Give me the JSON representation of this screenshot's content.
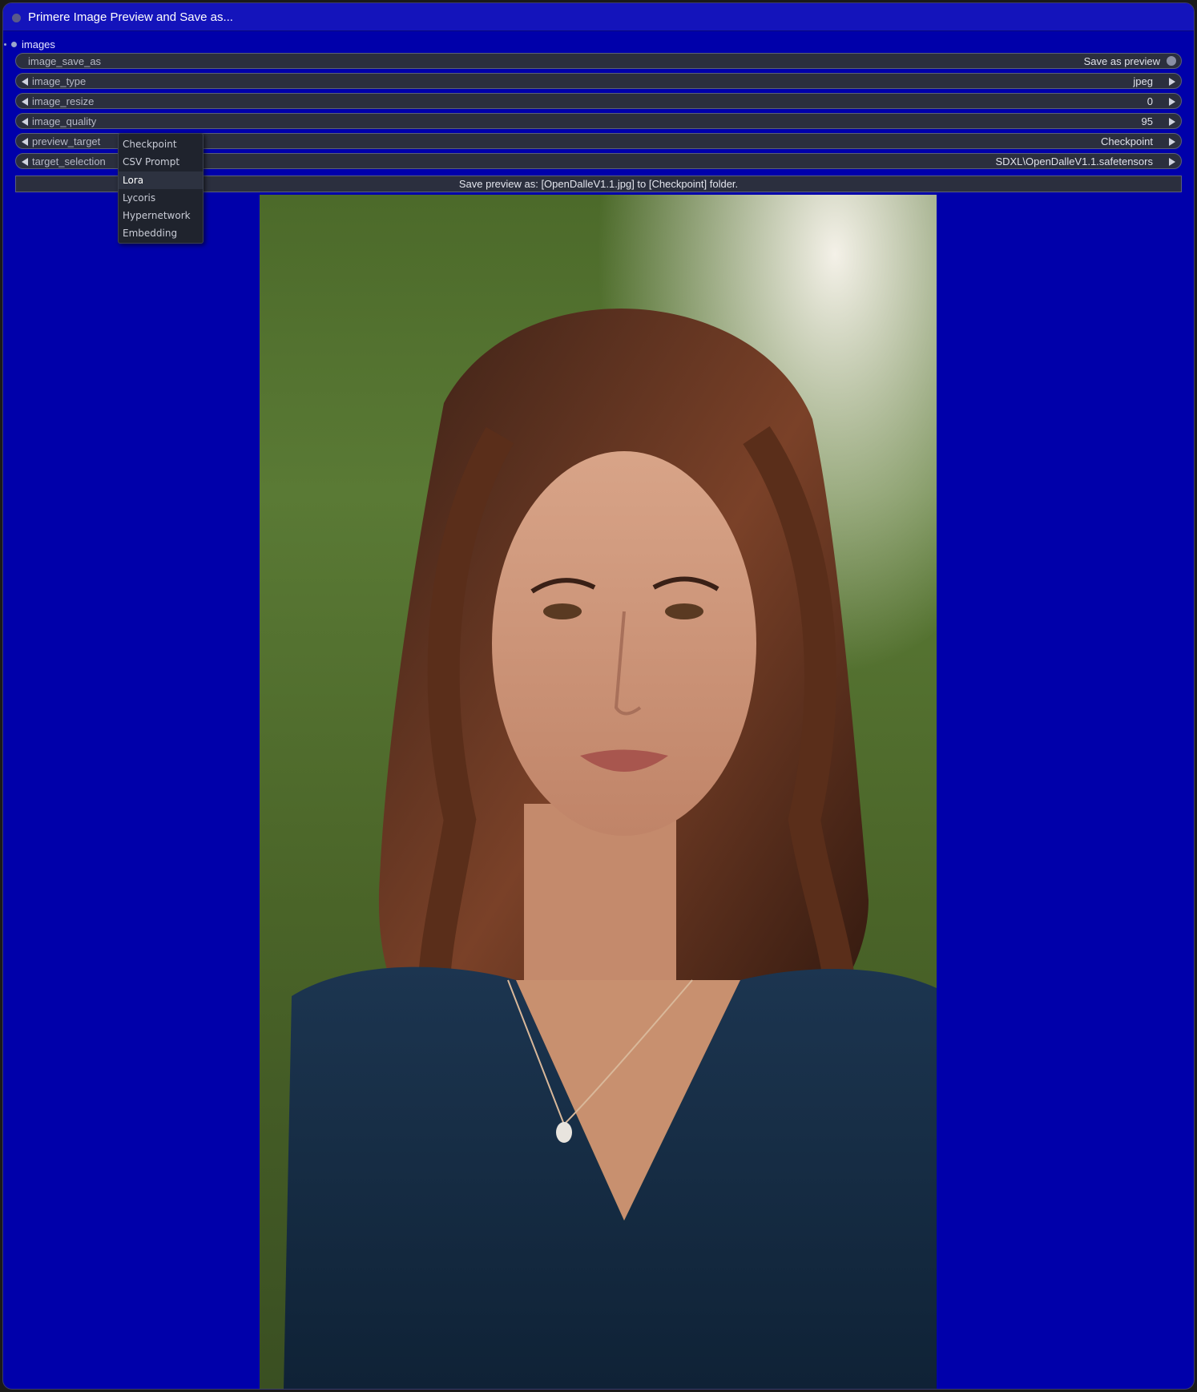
{
  "node": {
    "title": "Primere Image Preview and Save as...",
    "output_label": "images"
  },
  "widgets": {
    "image_save_as": {
      "name": "image_save_as",
      "value": "Save as preview"
    },
    "image_type": {
      "name": "image_type",
      "value": "jpeg"
    },
    "image_resize": {
      "name": "image_resize",
      "value": "0"
    },
    "image_quality": {
      "name": "image_quality",
      "value": "95"
    },
    "preview_target": {
      "name": "preview_target",
      "value": "Checkpoint"
    },
    "target_selection": {
      "name": "target_selection",
      "value": "SDXL\\OpenDalleV1.1.safetensors"
    }
  },
  "info": "Save preview as:  [OpenDalleV1.1.jpg] to [Checkpoint] folder.",
  "dropdown": {
    "items": [
      "Checkpoint",
      "CSV Prompt",
      "Lora",
      "Lycoris",
      "Hypernetwork",
      "Embedding"
    ],
    "highlighted": "Lora"
  },
  "colors": {
    "node_bg": "#0000aa",
    "title_bg": "#1414bb",
    "widget_bg": "#2b2f3e",
    "dropdown_bg": "#1f232d"
  }
}
